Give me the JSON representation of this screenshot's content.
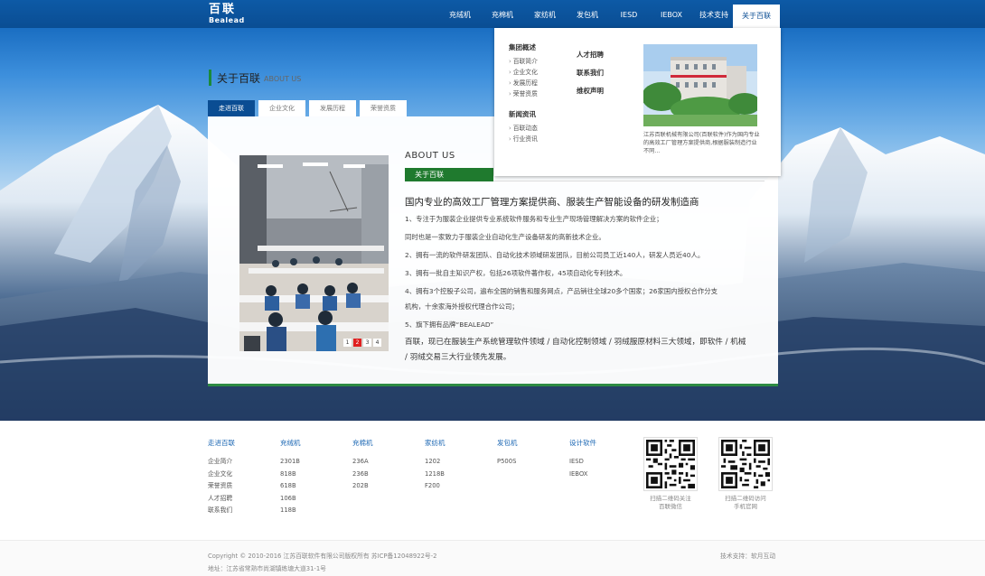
{
  "header": {
    "logo_cn": "百联",
    "logo_en": "Bealead",
    "nav": [
      "充绒机",
      "充棉机",
      "家纺机",
      "发包机",
      "IESD",
      "IEBOX",
      "技术支持",
      "关于百联"
    ]
  },
  "page_title": {
    "cn": "关于百联",
    "en": "ABOUT US"
  },
  "tabs": [
    "走进百联",
    "企业文化",
    "发展历程",
    "荣誉资质"
  ],
  "slider": {
    "dots": [
      "1",
      "2",
      "3",
      "4"
    ],
    "active_index": 2
  },
  "about": {
    "heading_en": "ABOUT US",
    "tag": "关于百联",
    "headline": "国内专业的高效工厂管理方案提供商、服装生产智能设备的研发制造商",
    "p1": "1、专注于为服装企业提供专业系统软件服务和专业生产现场管理解决方案的软件企业；",
    "p2": "同时也是一家致力于服装企业自动化生产设备研发的高新技术企业。",
    "p3": "2、拥有一流的软件研发团队、自动化技术领域研发团队，目前公司员工近140人，研发人员近40人。",
    "p4": "3、拥有一批自主知识产权，包括26项软件著作权，45项自动化专利技术。",
    "p5a": "4、拥有3个控股子公司，遍布全国的销售和服务网点，产品销往全球20多个国家；26家国内授权合作分支",
    "p5b": "机构，十余家海外授权代理合作公司；",
    "p6": "5、旗下拥有品牌“BEALEAD”",
    "last": "百联，现已在服装生产系统管理软件领域 / 自动化控制领域 / 羽绒服原材料三大领域，即软件 / 机械 / 羽绒交易三大行业领先发展。"
  },
  "dropdown": {
    "group1_title": "集团概述",
    "group1_items": [
      "百联简介",
      "企业文化",
      "发展历程",
      "荣誉资质"
    ],
    "group2_title": "新闻资讯",
    "group2_items": [
      "百联动态",
      "行业资讯"
    ],
    "col2": [
      "人才招聘",
      "联系我们",
      "维权声明"
    ],
    "desc": "江苏百联机械有限公司(百联软件)作为国内专业的高效工厂管理方案提供商,根据服装制造行业不同..."
  },
  "footer": {
    "columns": [
      {
        "title": "走进百联",
        "items": [
          "企业简介",
          "企业文化",
          "荣誉资质",
          "人才招聘",
          "联系我们"
        ]
      },
      {
        "title": "充绒机",
        "items": [
          "2301B",
          "818B",
          "618B",
          "106B",
          "118B"
        ]
      },
      {
        "title": "充棉机",
        "items": [
          "236A",
          "236B",
          "202B"
        ]
      },
      {
        "title": "家纺机",
        "items": [
          "1202",
          "1218B",
          "F200"
        ]
      },
      {
        "title": "发包机",
        "items": [
          "P500S"
        ]
      },
      {
        "title": "设计软件",
        "items": [
          "IESD",
          "IEBOX"
        ]
      }
    ],
    "qr1_caption": [
      "扫描二维码关注",
      "百联微信"
    ],
    "qr2_caption": [
      "扫描二维码访问",
      "手机官网"
    ]
  },
  "bottom": {
    "copyright": "Copyright © 2010-2016 江苏百联软件有限公司版权所有 苏ICP备12048922号-2",
    "address": "地址：江苏省常熟市尚湖镇练塘大道31-1号",
    "support": "技术支持：软月互动"
  },
  "colors": {
    "nav_blue": "#0a4d93",
    "accent_green": "#1f7a2e",
    "active_dot": "#e02020"
  }
}
